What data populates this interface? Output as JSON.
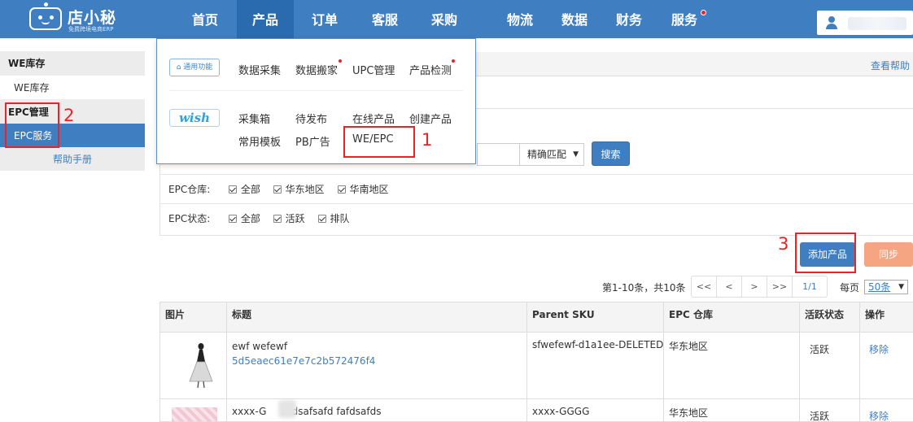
{
  "header": {
    "logo_title": "店小秘",
    "logo_subtitle": "免费跨境电商ERP",
    "nav": [
      {
        "label": "首页"
      },
      {
        "label": "产品"
      },
      {
        "label": "订单"
      },
      {
        "label": "客服"
      },
      {
        "label": "采购"
      },
      {
        "label": "物流"
      },
      {
        "label": "数据"
      },
      {
        "label": "财务"
      },
      {
        "label": "服务"
      }
    ],
    "active_nav": "产品"
  },
  "dropdown": {
    "general_badge": "通用功能",
    "general_links": [
      "数据采集",
      "数据搬家",
      "UPC管理",
      "产品检测"
    ],
    "wish_badge": "wish",
    "wish_links_row1": [
      "采集箱",
      "待发布",
      "在线产品",
      "创建产品"
    ],
    "wish_links_row2": [
      "常用模板",
      "PB广告",
      "WE/EPC"
    ]
  },
  "sidebar": {
    "group1_title": "WE库存",
    "group1_item": "WE库存",
    "group2_title": "EPC管理",
    "group2_item": "EPC服务",
    "help": "帮助手册"
  },
  "main": {
    "help_link": "查看帮助",
    "match_select": "精确匹配",
    "search_button": "搜索",
    "warehouse_label": "EPC仓库:",
    "warehouse_options": [
      "全部",
      "华东地区",
      "华南地区"
    ],
    "status_label": "EPC状态:",
    "status_options": [
      "全部",
      "活跃",
      "排队"
    ],
    "add_button": "添加产品",
    "sync_button": "同步",
    "pager_info": "第1-10条，共10条",
    "pager_buttons": [
      "<<",
      "<",
      ">",
      ">>"
    ],
    "pager_page": "1/1",
    "per_page_label": "每页",
    "per_page_value": "50条"
  },
  "table": {
    "headers": [
      "图片",
      "标题",
      "Parent SKU",
      "EPC 仓库",
      "活跃状态",
      "操作"
    ],
    "rows": [
      {
        "title": "ewf wefewf",
        "id": "5d5eaec61e7e7c2b572476f4",
        "sku": "sfwefewf-d1a1ee-DELETED",
        "warehouse": "华东地区",
        "status": "活跃",
        "action": "移除"
      },
      {
        "title": "xxxx-G      ffdsafsafd fafdsafds",
        "id": "",
        "sku": "xxxx-GGGG",
        "warehouse": "华东地区",
        "status": "活跃",
        "action": "移除"
      }
    ]
  },
  "annotations": [
    "1",
    "2",
    "3"
  ],
  "colors": {
    "primary": "#3f7ec0",
    "sync": "#f5a582",
    "annotation": "#e22222"
  }
}
